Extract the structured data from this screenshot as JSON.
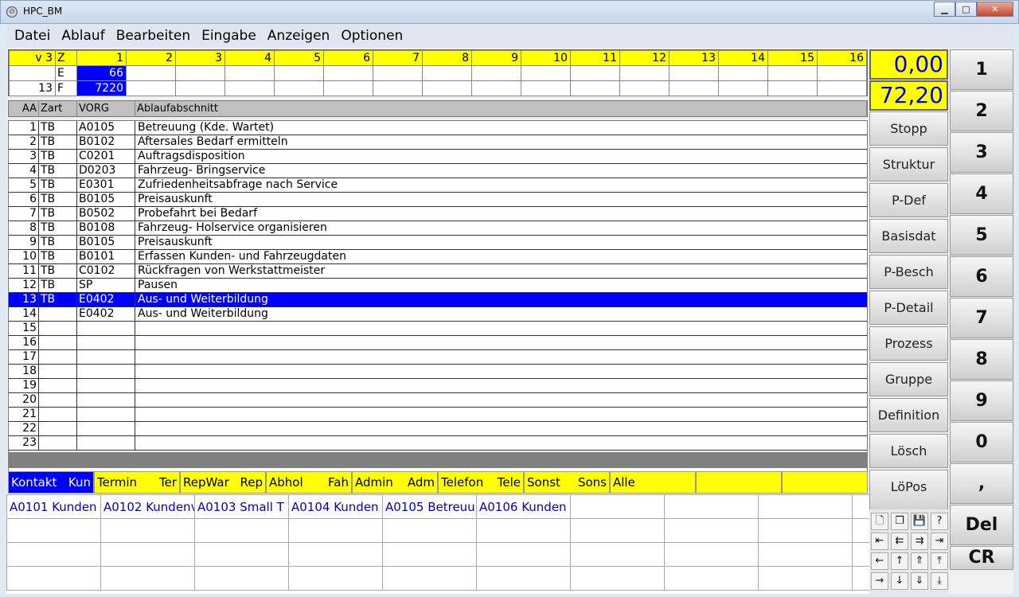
{
  "window": {
    "title": "HPC_BM"
  },
  "menu": [
    "Datei",
    "Ablauf",
    "Bearbeiten",
    "Eingabe",
    "Anzeigen",
    "Optionen"
  ],
  "topgrid": {
    "header": [
      "v 3",
      "Z",
      "1",
      "2",
      "3",
      "4",
      "5",
      "6",
      "7",
      "8",
      "9",
      "10",
      "11",
      "12",
      "13",
      "14",
      "15",
      "16"
    ],
    "row_e": {
      "a": "",
      "z": "E",
      "v1": "66"
    },
    "row_f": {
      "a": "13",
      "z": "F",
      "v1": "7220"
    }
  },
  "list": {
    "columns": [
      "AA",
      "Zart",
      "VORG",
      "Ablaufabschnitt"
    ],
    "rows": [
      [
        "1",
        "TB",
        "A0105",
        "Betreuung (Kde. Wartet)"
      ],
      [
        "2",
        "TB",
        "B0102",
        "Aftersales Bedarf ermitteln"
      ],
      [
        "3",
        "TB",
        "C0201",
        "Auftragsdisposition"
      ],
      [
        "4",
        "TB",
        "D0203",
        "Fahrzeug- Bringservice"
      ],
      [
        "5",
        "TB",
        "E0301",
        "Zufriedenheitsabfrage nach Service"
      ],
      [
        "6",
        "TB",
        "B0105",
        "Preisauskunft"
      ],
      [
        "7",
        "TB",
        "B0502",
        "Probefahrt bei Bedarf"
      ],
      [
        "8",
        "TB",
        "B0108",
        "Fahrzeug- Holservice organisieren"
      ],
      [
        "9",
        "TB",
        "B0105",
        "Preisauskunft"
      ],
      [
        "10",
        "TB",
        "B0101",
        "Erfassen Kunden- und Fahrzeugdaten"
      ],
      [
        "11",
        "TB",
        "C0102",
        "Rückfragen von Werkstattmeister"
      ],
      [
        "12",
        "TB",
        "SP",
        "Pausen"
      ],
      [
        "13",
        "TB",
        "E0402",
        "Aus- und Weiterbildung"
      ],
      [
        "14",
        "",
        "E0402",
        "Aus- und Weiterbildung"
      ],
      [
        "15",
        "",
        "",
        ""
      ],
      [
        "16",
        "",
        "",
        ""
      ],
      [
        "17",
        "",
        "",
        ""
      ],
      [
        "18",
        "",
        "",
        ""
      ],
      [
        "19",
        "",
        "",
        ""
      ],
      [
        "20",
        "",
        "",
        ""
      ],
      [
        "21",
        "",
        "",
        ""
      ],
      [
        "22",
        "",
        "",
        ""
      ],
      [
        "23",
        "",
        "",
        ""
      ]
    ],
    "selected_index": 12
  },
  "categories": [
    [
      "Kontakt",
      "Kun"
    ],
    [
      "Termin",
      "Ter"
    ],
    [
      "RepWar",
      "Rep"
    ],
    [
      "Abhol",
      "Fah"
    ],
    [
      "Admin",
      "Adm"
    ],
    [
      "Telefon",
      "Tele"
    ],
    [
      "Sonst",
      "Sons"
    ],
    [
      "Alle",
      ""
    ],
    [
      "",
      ""
    ],
    [
      "",
      ""
    ]
  ],
  "active_category": 0,
  "items": [
    "A0101 Kunden",
    "A0102 Kundenv",
    "A0103 Small T",
    "A0104 Kunden",
    "A0105 Betreuu",
    "A0106 Kunden"
  ],
  "display": {
    "top": "0,00",
    "bottom": "72,20"
  },
  "func_buttons": [
    "Stopp",
    "Struktur",
    "P-Def",
    "Basisdat",
    "P-Besch",
    "P-Detail",
    "Prozess",
    "Gruppe",
    "Definition",
    "Lösch",
    "LöPos"
  ],
  "keypad": [
    "1",
    "2",
    "3",
    "4",
    "5",
    "6",
    "7",
    "8",
    "9",
    "0",
    ",",
    "Del",
    "CR"
  ],
  "toolbar_icons": [
    [
      "new-document-icon",
      "🗋"
    ],
    [
      "copy-icon",
      "❐"
    ],
    [
      "save-icon",
      "💾"
    ],
    [
      "help-icon",
      "?"
    ],
    [
      "first-icon",
      "⇤"
    ],
    [
      "prev-fast-icon",
      "⇇"
    ],
    [
      "next-fast-icon",
      "⇉"
    ],
    [
      "last-icon",
      "⇥"
    ],
    [
      "left-icon",
      "←"
    ],
    [
      "up-icon",
      "↑"
    ],
    [
      "up-fast-icon",
      "⇑"
    ],
    [
      "top-icon",
      "⤒"
    ],
    [
      "right-icon",
      "→"
    ],
    [
      "down-icon",
      "↓"
    ],
    [
      "down-fast-icon",
      "⇓"
    ],
    [
      "bottom-icon",
      "⤓"
    ]
  ],
  "colors": {
    "highlight": "#0000ff",
    "yellow": "#ffff00"
  }
}
